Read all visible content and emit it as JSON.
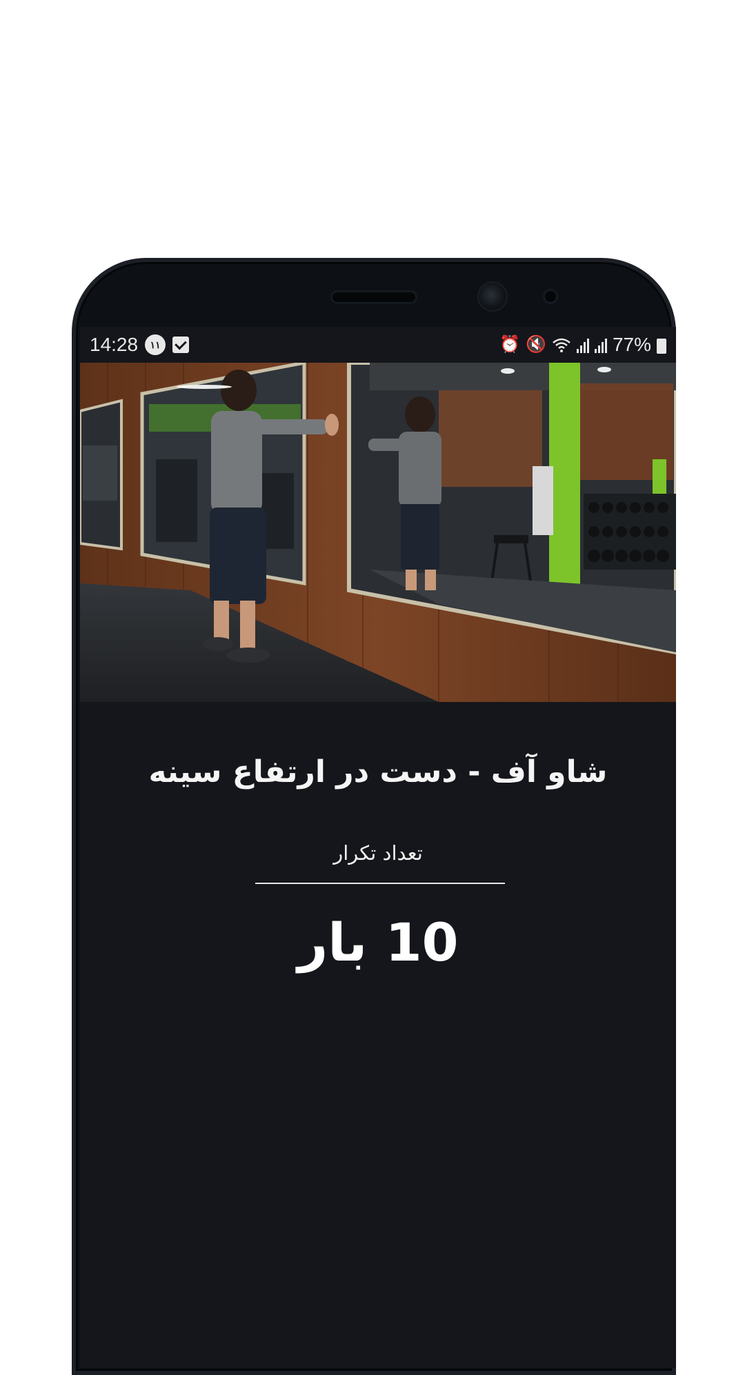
{
  "status_bar": {
    "time": "14:28",
    "notification_count": "۱۱",
    "battery": "77%"
  },
  "exercise": {
    "title": "شاو آف - دست در ارتفاع سینه",
    "reps_label": "تعداد تکرار",
    "reps_value": "10 بار",
    "image_icon": "gym-exercise-photo"
  },
  "colors": {
    "screen_background": "#15161b",
    "text": "#f5f5f5",
    "gym_accent_green": "#7dc42a",
    "wood_panel": "#7a4326"
  }
}
